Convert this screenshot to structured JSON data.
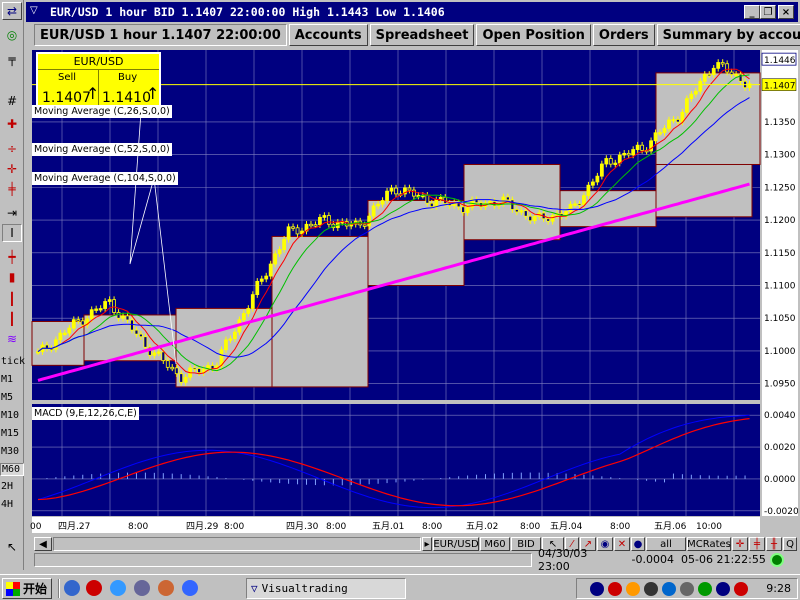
{
  "window": {
    "title": "EUR/USD 1 hour BID 1.1407 22:00:00 High 1.1443 Low 1.1406",
    "minimize": "_",
    "restore": "❐",
    "close": "×"
  },
  "tabs": [
    {
      "label": "EUR/USD 1 hour 1.1407 22:00:00"
    },
    {
      "label": "Accounts"
    },
    {
      "label": "Spreadsheet"
    },
    {
      "label": "Open Position"
    },
    {
      "label": "Orders"
    },
    {
      "label": "Summary by accounts"
    }
  ],
  "quote": {
    "pair": "EUR/USD",
    "sell_label": "Sell",
    "buy_label": "Buy",
    "sell_price": "1.1407",
    "buy_price": "1.1410",
    "sell_arrow": "↑",
    "buy_arrow": "↑"
  },
  "indicators": {
    "ma1": "Moving Average (C,26,S,0,0)",
    "ma2": "Moving Average (C,52,S,0,0)",
    "ma3": "Moving Average (C,104,S,0,0)",
    "macd": "MACD (9,E,12,26,C,E)"
  },
  "price_axis": {
    "ticks": [
      "1.1350",
      "1.1300",
      "1.1250",
      "1.1200",
      "1.1150",
      "1.1100",
      "1.1050",
      "1.1000",
      "1.0950"
    ],
    "last_price": "1.1407",
    "high_marker": "1.1446"
  },
  "macd_axis": {
    "ticks": [
      "0.0040",
      "0.0020",
      "0.0000",
      "-0.0020"
    ]
  },
  "time_axis": {
    "ticks": [
      "00",
      "四月.27",
      "8:00",
      "四月.29",
      "8:00",
      "四月.30",
      "8:00",
      "五月.01",
      "8:00",
      "五月.02",
      "8:00",
      "五月.04",
      "8:00",
      "五月.06",
      "10:00"
    ]
  },
  "timeframes": [
    "tick",
    "M1",
    "M5",
    "M10",
    "M15",
    "M30",
    "M60",
    "2H",
    "4H"
  ],
  "bottom_toolbar": {
    "pair_button": "EUR/USD",
    "tf_button": "M60",
    "price_button": "BID",
    "all_button": "all",
    "rates_button": "MCRates",
    "q_button": "Q"
  },
  "status": {
    "cursor_time": "04/30/03 23:00",
    "cursor_value": "-0.0004",
    "clock": "05-06 21:22:55"
  },
  "taskbar": {
    "start_label": "开始",
    "app_label": "Visualtrading",
    "time": "9:28"
  },
  "colors": {
    "chart_bg": "#000080",
    "candle": "#ffff00",
    "box_fill": "#c0c0c0",
    "ma_fast": "#ff0000",
    "ma_mid": "#00c000",
    "ma_slow": "#0000ff",
    "ma_trend": "#ff00ff",
    "macd_line": "#0000ff",
    "signal_line": "#ff0000"
  },
  "chart_data": {
    "type": "line",
    "series": [
      {
        "values": [
          1.0995,
          1.104,
          1.1075,
          1.101,
          1.096,
          1.098,
          1.108,
          1.118,
          1.12,
          1.119,
          1.125,
          1.123,
          1.122,
          1.123,
          1.12,
          1.1215,
          1.129,
          1.131,
          1.136,
          1.144,
          1.1407
        ]
      }
    ],
    "ylim": [
      1.0925,
      1.146
    ]
  }
}
